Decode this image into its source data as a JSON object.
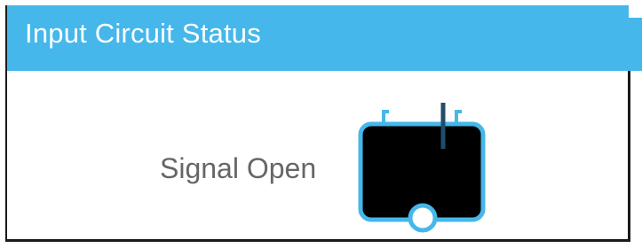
{
  "panel": {
    "title": "Input Circuit Status"
  },
  "status": {
    "label": "Signal Open",
    "icon": "open-circuit-icon"
  },
  "colors": {
    "header_bg": "#45b7ea",
    "icon_outline": "#45b7ea",
    "icon_fill": "#000000",
    "switch_color": "#1f4e6b",
    "label_text": "#666666"
  }
}
